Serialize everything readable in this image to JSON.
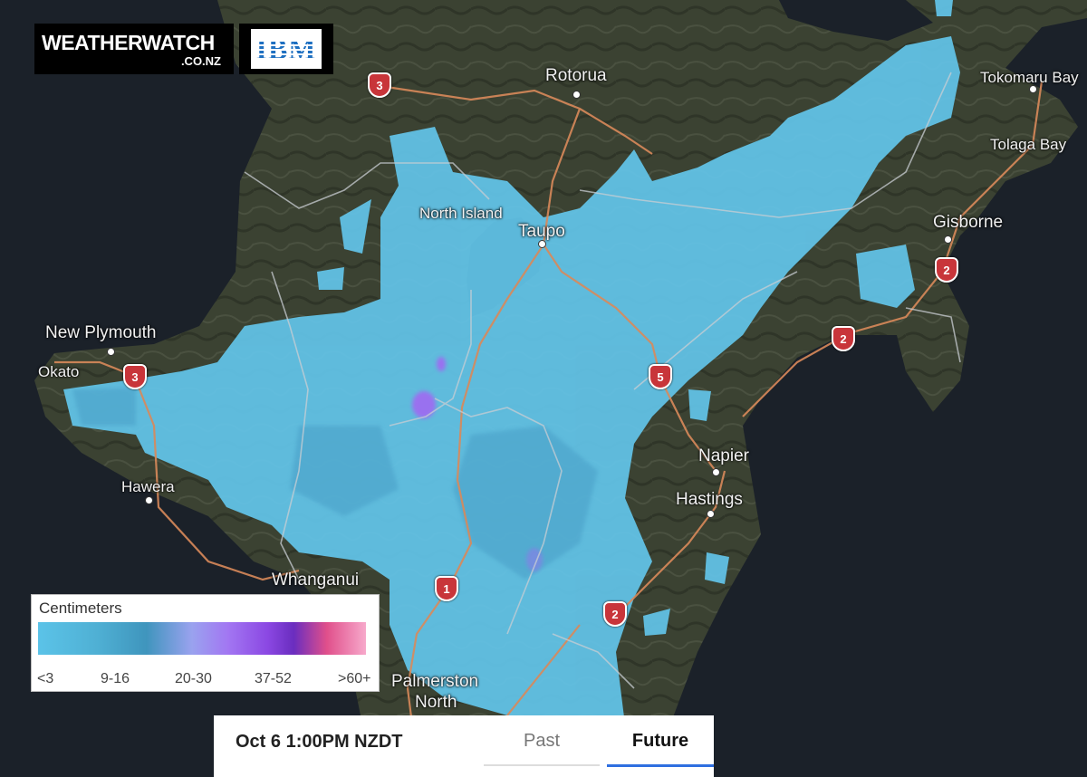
{
  "logos": {
    "weatherwatch": {
      "word": "WEATHERWATCH",
      "sub": ".CO.NZ"
    },
    "ibm": {
      "word": "IBM"
    }
  },
  "places": [
    {
      "name": "Rotorua"
    },
    {
      "name": "Tokomaru Bay"
    },
    {
      "name": "Tolaga Bay"
    },
    {
      "name": "North Island"
    },
    {
      "name": "Taupo"
    },
    {
      "name": "Gisborne"
    },
    {
      "name": "New Plymouth"
    },
    {
      "name": "Okato"
    },
    {
      "name": "Hawera"
    },
    {
      "name": "Napier"
    },
    {
      "name": "Hastings"
    },
    {
      "name": "Whanganui"
    },
    {
      "name": "Palmerston"
    },
    {
      "name": "North"
    }
  ],
  "highways": [
    "3",
    "3",
    "5",
    "2",
    "2",
    "1",
    "2"
  ],
  "legend": {
    "title": "Centimeters",
    "ticks": [
      "<3",
      "9-16",
      "20-30",
      "37-52",
      ">60+"
    ],
    "gradient": [
      "#5bc3e8",
      "#3f95bd",
      "#a276f2",
      "#6a2dbf",
      "#e04f8b",
      "#f7a9cb"
    ]
  },
  "timebar": {
    "time": "Oct 6 1:00PM NZDT",
    "tabs": {
      "past": "Past",
      "future": "Future"
    },
    "active": "future"
  },
  "colors": {
    "land": "#3d4433",
    "sea": "#1b2129",
    "precip": "#63c5ea",
    "precip_heavy": "#a069f2",
    "road": "#d9895a",
    "boundary": "#c9cdd3",
    "shield": "#c8353a"
  }
}
